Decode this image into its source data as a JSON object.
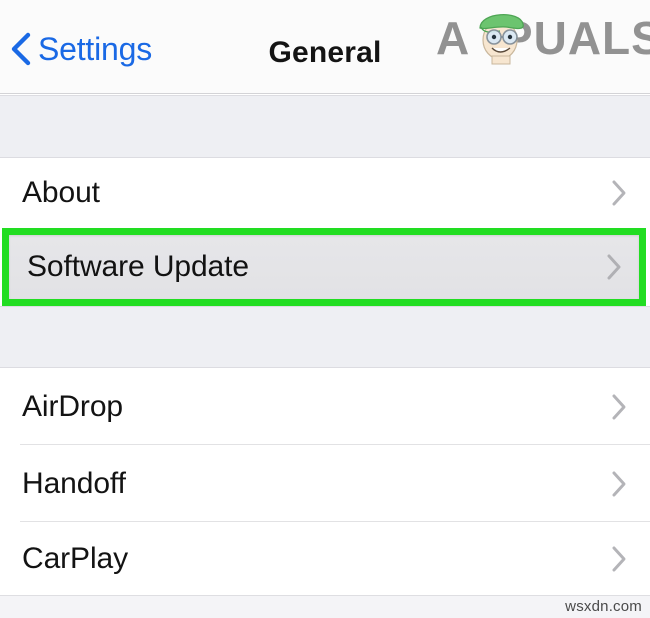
{
  "navbar": {
    "back_label": "Settings",
    "back_icon": "chevron-left-icon",
    "title": "General",
    "accent_color": "#1a69e5",
    "title_color": "#141414"
  },
  "watermark": {
    "brand_text_before": "A",
    "brand_text_after": "PUALS",
    "brand_full": "APPUALS",
    "brand_color": "#8a8a8a",
    "mascot_icon": "mascot-face-icon",
    "mascot_hat_color": "#5bbd62",
    "mascot_skin_color": "#f5e2cb",
    "footer_text": "wsxdn.com"
  },
  "sections": [
    {
      "name": "section-one",
      "rows": [
        {
          "label": "About",
          "accessory": "chevron-right-icon",
          "highlighted": false
        },
        {
          "label": "Software Update",
          "accessory": "chevron-right-icon",
          "highlighted": true
        }
      ]
    },
    {
      "name": "section-two",
      "rows": [
        {
          "label": "AirDrop",
          "accessory": "chevron-right-icon",
          "highlighted": false
        },
        {
          "label": "Handoff",
          "accessory": "chevron-right-icon",
          "highlighted": false
        },
        {
          "label": "CarPlay",
          "accessory": "chevron-right-icon",
          "highlighted": false
        }
      ]
    }
  ],
  "highlight": {
    "border_color": "#22dd22",
    "fill_color": "#e4e4e7"
  }
}
